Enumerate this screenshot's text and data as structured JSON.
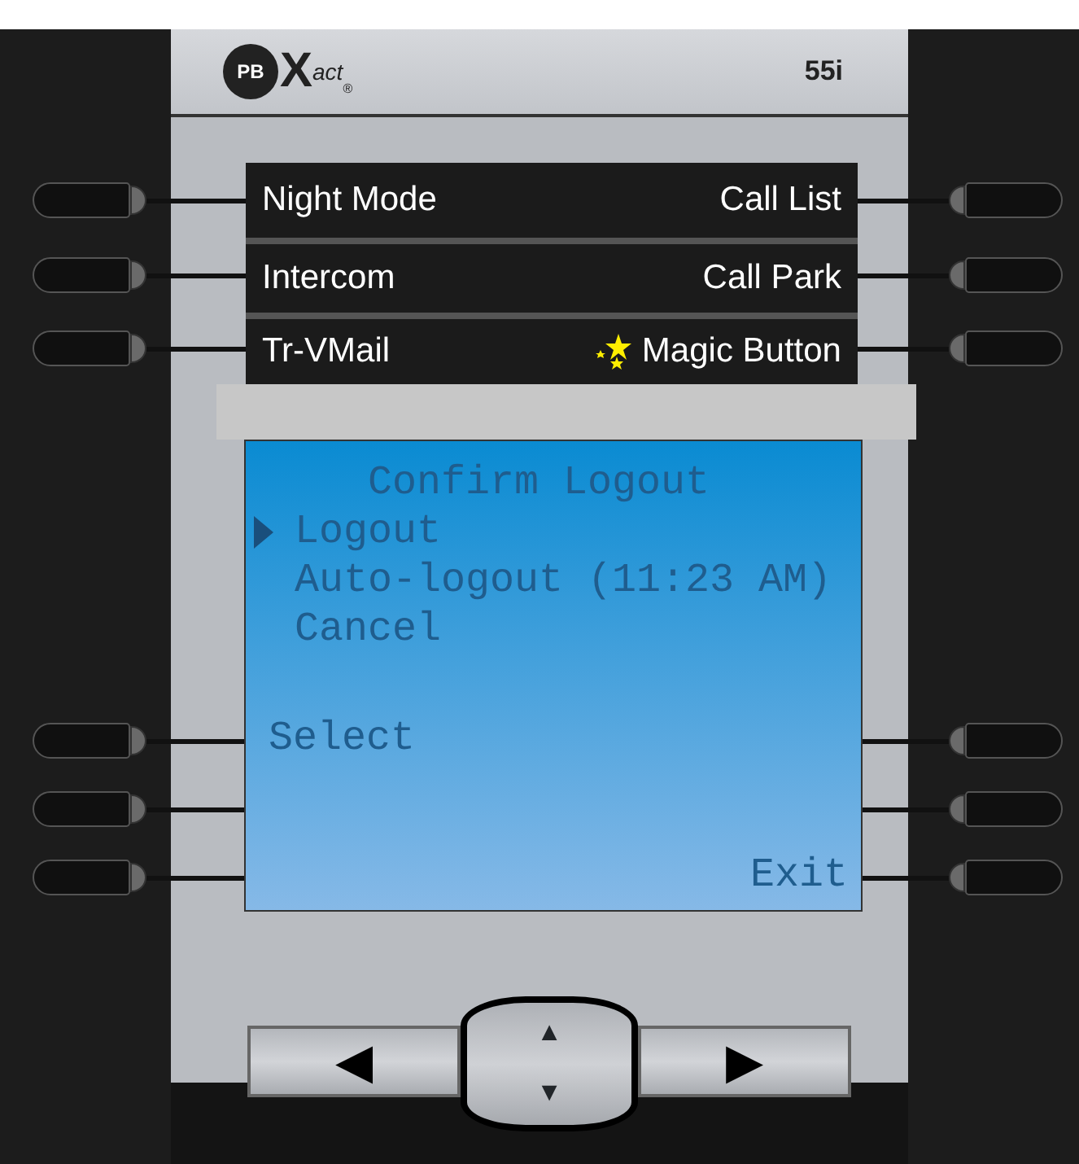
{
  "header": {
    "logo": {
      "badge": "PB",
      "mark": "X",
      "suffix": "act",
      "registered": "®"
    },
    "model": "55i"
  },
  "top_keys": [
    {
      "left": "Night Mode",
      "right": "Call List",
      "kind": "plain"
    },
    {
      "left": "Intercom",
      "right": "Call Park",
      "kind": "plain"
    },
    {
      "left": "Tr-VMail",
      "right": "Magic Button",
      "kind": "starred"
    }
  ],
  "screen": {
    "title": "Confirm Logout",
    "options": [
      {
        "label": "Logout",
        "selected": true
      },
      {
        "label": "Auto-logout (11:23 AM)",
        "selected": false
      },
      {
        "label": "Cancel",
        "selected": false
      }
    ],
    "softkey_rows": [
      {
        "left": "Select"
      },
      {},
      {
        "right": "Exit"
      }
    ]
  },
  "nav": {
    "left": "◀",
    "up": "▲",
    "down": "▼",
    "right": "▶"
  }
}
